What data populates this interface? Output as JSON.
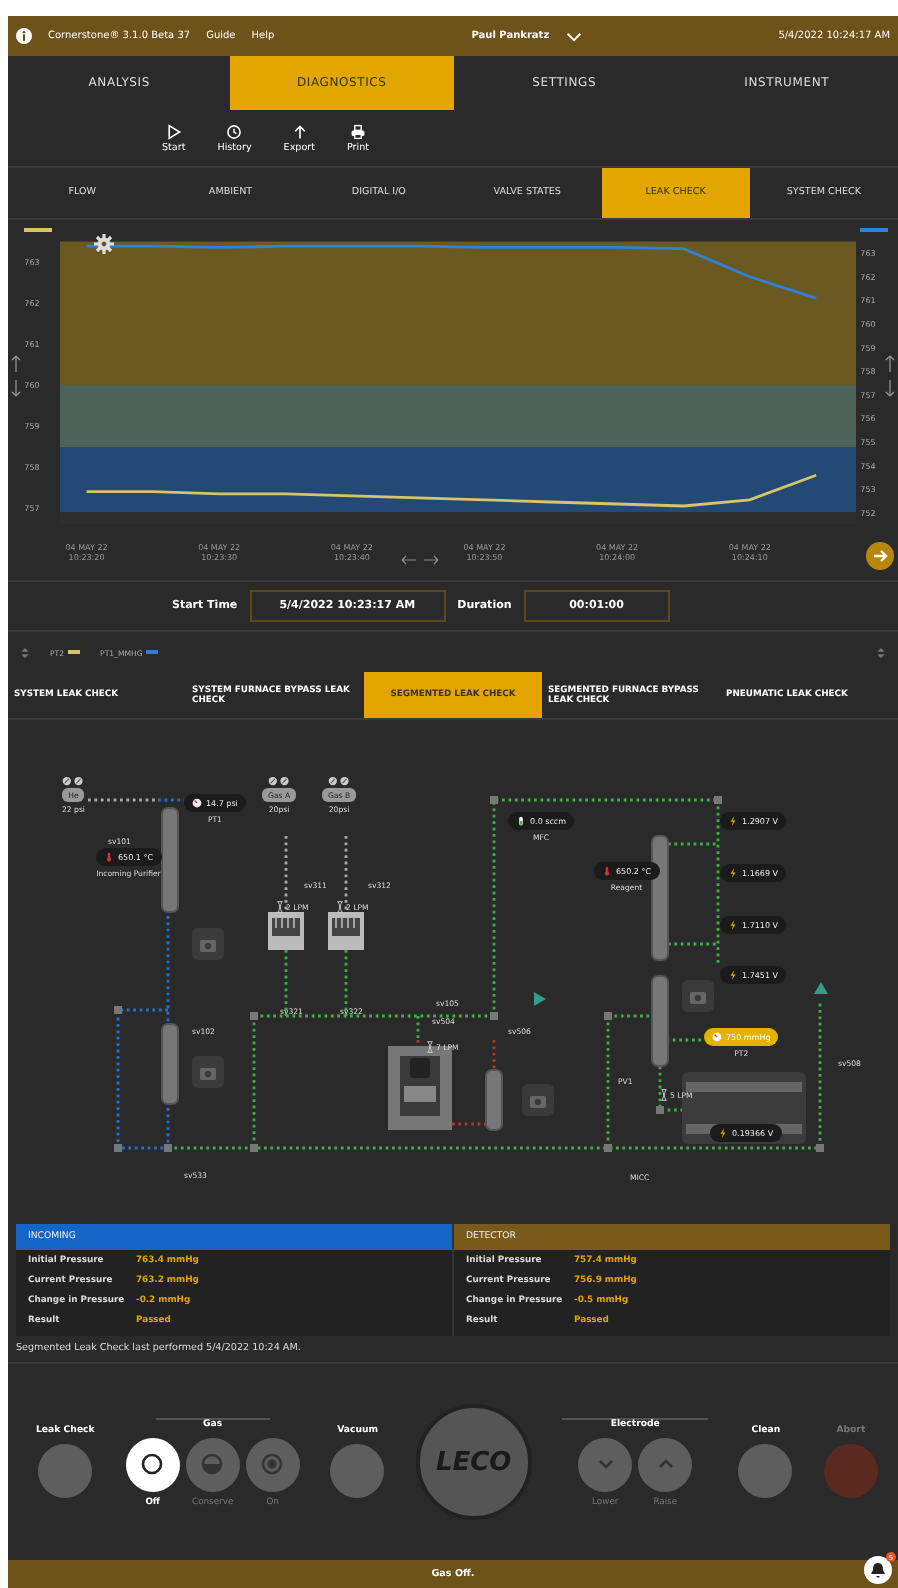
{
  "top_bar": {
    "app": "Cornerstone® 3.1.0 Beta 37",
    "links": [
      "Guide",
      "Help"
    ],
    "user": "Paul Pankratz",
    "datetime": "5/4/2022 10:24:17 AM"
  },
  "main_tabs": [
    {
      "label": "ANALYSIS",
      "selected": false
    },
    {
      "label": "DIAGNOSTICS",
      "selected": true
    },
    {
      "label": "SETTINGS",
      "selected": false
    },
    {
      "label": "INSTRUMENT",
      "selected": false
    }
  ],
  "toolbar": [
    {
      "kind": "start",
      "label": "Start"
    },
    {
      "kind": "history",
      "label": "History"
    },
    {
      "kind": "export",
      "label": "Export"
    },
    {
      "kind": "print",
      "label": "Print"
    }
  ],
  "sub_tabs": [
    {
      "label": "FLOW",
      "selected": false
    },
    {
      "label": "AMBIENT",
      "selected": false
    },
    {
      "label": "DIGITAL I/O",
      "selected": false
    },
    {
      "label": "VALVE STATES",
      "selected": false
    },
    {
      "label": "LEAK CHECK",
      "selected": true
    },
    {
      "label": "SYSTEM CHECK",
      "selected": false
    }
  ],
  "chart": {
    "chart_data": {
      "type": "line",
      "categories": [
        "04 MAY 22\n10:23:20",
        null,
        "04 MAY 22\n10:23:30",
        null,
        "04 MAY 22\n10:23:40",
        null,
        "04 MAY 22\n10:23:50",
        null,
        "04 MAY 22\n10:24:00",
        null,
        "04 MAY 22\n10:24:10",
        null
      ],
      "ylim": [
        756.6,
        763.5
      ],
      "yticks": [
        757,
        758,
        759,
        760,
        761,
        762,
        763
      ],
      "y2lim": [
        751.5,
        763.5
      ],
      "y2ticks": [
        752,
        753,
        754,
        755,
        756,
        757,
        758,
        759,
        760,
        761,
        762,
        763
      ],
      "series": [
        {
          "name": "PT2",
          "color": "#d8c46a",
          "values": [
            757.4,
            757.4,
            757.35,
            757.35,
            757.3,
            757.25,
            757.2,
            757.15,
            757.1,
            757.05,
            757.2,
            757.8
          ]
        },
        {
          "name": "PT1_MMHG",
          "color": "#2f80d8",
          "axis": "y2",
          "values": [
            763.3,
            763.3,
            763.25,
            763.3,
            763.3,
            763.3,
            763.25,
            763.25,
            763.25,
            763.2,
            762.0,
            761.1
          ]
        }
      ]
    }
  },
  "time_range": {
    "start_label": "Start Time",
    "start": "5/4/2022 10:23:17 AM",
    "duration_label": "Duration",
    "duration": "00:01:00"
  },
  "leak_tabs": [
    {
      "label": "SYSTEM LEAK CHECK",
      "selected": false
    },
    {
      "label": "SYSTEM FURNACE BYPASS LEAK CHECK",
      "selected": false
    },
    {
      "label": "SEGMENTED LEAK CHECK",
      "selected": true
    },
    {
      "label": "SEGMENTED FURNACE BYPASS LEAK CHECK",
      "selected": false
    },
    {
      "label": "PNEUMATIC LEAK CHECK",
      "selected": false
    }
  ],
  "diagram": [
    {
      "kind": "gas",
      "label": "He",
      "reading": "22 psi"
    },
    {
      "kind": "tag",
      "label": "sv101"
    },
    {
      "kind": "gauge",
      "value": "14.7 psi",
      "caption": "PT1",
      "alert": false
    },
    {
      "kind": "gas",
      "label": "Gas A",
      "reading": "20psi"
    },
    {
      "kind": "gas",
      "label": "Gas B",
      "reading": "20psi"
    },
    {
      "kind": "temp",
      "value": "650.1 °C",
      "caption": "Incoming Purifier"
    },
    {
      "kind": "tag",
      "label": "sv311"
    },
    {
      "kind": "tag",
      "label": "sv312"
    },
    {
      "kind": "flow",
      "value": "2 LPM"
    },
    {
      "kind": "flow",
      "value": "2 LPM"
    },
    {
      "kind": "mfc",
      "value": "0.0 sccm",
      "caption": "MFC"
    },
    {
      "kind": "temp",
      "value": "650.2 °C",
      "caption": "Reagent"
    },
    {
      "kind": "volt",
      "value": "1.2907 V"
    },
    {
      "kind": "volt",
      "value": "1.1669 V"
    },
    {
      "kind": "volt",
      "value": "1.7110 V"
    },
    {
      "kind": "volt",
      "value": "1.7451 V"
    },
    {
      "kind": "tag",
      "label": "sv321"
    },
    {
      "kind": "tag",
      "label": "sv322"
    },
    {
      "kind": "tag",
      "label": "sv105"
    },
    {
      "kind": "tag",
      "label": "sv504"
    },
    {
      "kind": "tag",
      "label": "sv102"
    },
    {
      "kind": "tag",
      "label": "sv506"
    },
    {
      "kind": "flow",
      "value": "7 LPM"
    },
    {
      "kind": "tag",
      "label": "PV1"
    },
    {
      "kind": "flow",
      "value": "5 LPM"
    },
    {
      "kind": "gauge",
      "value": "750 mmHg",
      "caption": "PT2",
      "alert": true
    },
    {
      "kind": "tag",
      "label": "sv508"
    },
    {
      "kind": "volt",
      "value": "0.19366 V"
    },
    {
      "kind": "tag",
      "label": "sv533"
    },
    {
      "kind": "tag",
      "label": "MICC"
    }
  ],
  "results": [
    {
      "title": "INCOMING",
      "color": "#1565c8",
      "rows": [
        {
          "label": "Initial Pressure",
          "value": "763.4 mmHg"
        },
        {
          "label": "Current Pressure",
          "value": "763.2 mmHg"
        },
        {
          "label": "Change in Pressure",
          "value": "-0.2 mmHg"
        },
        {
          "label": "Result",
          "value": "Passed"
        }
      ]
    },
    {
      "title": "DETECTOR",
      "color": "#7a5a1a",
      "rows": [
        {
          "label": "Initial Pressure",
          "value": "757.4 mmHg"
        },
        {
          "label": "Current Pressure",
          "value": "756.9 mmHg"
        },
        {
          "label": "Change in Pressure",
          "value": "-0.5 mmHg"
        },
        {
          "label": "Result",
          "value": "Passed"
        }
      ]
    }
  ],
  "note": "Segmented Leak Check last performed 5/4/2022 10:24 AM.",
  "controls": [
    {
      "kind": "button",
      "label": "Leak Check",
      "disabled": false
    },
    {
      "kind": "choice",
      "label": "Gas",
      "options": [
        {
          "label": "Off",
          "selected": true
        },
        {
          "label": "Conserve",
          "selected": false
        },
        {
          "label": "On",
          "selected": false
        }
      ]
    },
    {
      "kind": "button",
      "label": "Vacuum",
      "disabled": false
    },
    {
      "kind": "logo",
      "label": "LECO"
    },
    {
      "kind": "actions",
      "label": "Electrode",
      "actions": [
        {
          "label": "Lower"
        },
        {
          "label": "Raise"
        }
      ]
    },
    {
      "kind": "button",
      "label": "Clean",
      "disabled": false
    },
    {
      "kind": "button",
      "label": "Abort",
      "disabled": true
    }
  ],
  "status_bar": {
    "text": "Gas Off.",
    "notifications": "5"
  }
}
